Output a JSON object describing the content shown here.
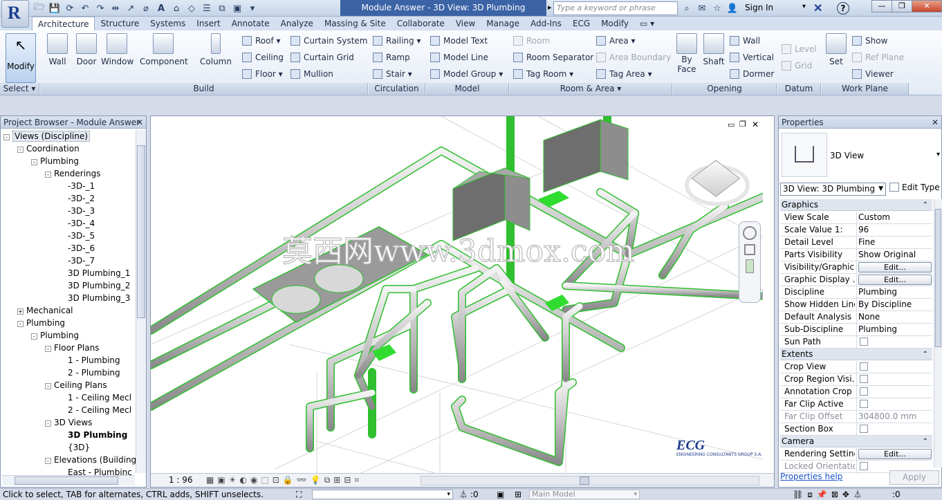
{
  "titlebar": {
    "document_title": "Module Answer - 3D View: 3D Plumbing",
    "search_placeholder": "Type a keyword or phrase",
    "sign_in": "Sign In"
  },
  "tabs": [
    "Architecture",
    "Structure",
    "Systems",
    "Insert",
    "Annotate",
    "Analyze",
    "Massing & Site",
    "Collaborate",
    "View",
    "Manage",
    "Add-Ins",
    "ECG",
    "Modify"
  ],
  "ribbon": {
    "modify": "Modify",
    "select": "Select",
    "build": {
      "label": "Build",
      "wall": "Wall",
      "door": "Door",
      "window": "Window",
      "component": "Component",
      "column": "Column",
      "roof": "Roof",
      "ceiling": "Ceiling",
      "floor": "Floor",
      "curtain_system": "Curtain System",
      "curtain_grid": "Curtain Grid",
      "mullion": "Mullion"
    },
    "circulation": {
      "label": "Circulation",
      "railing": "Railing",
      "ramp": "Ramp",
      "stair": "Stair"
    },
    "model": {
      "label": "Model",
      "model_text": "Model Text",
      "model_line": "Model Line",
      "model_group": "Model Group"
    },
    "room_area": {
      "label": "Room & Area",
      "room": "Room",
      "room_separator": "Room Separator",
      "tag_room": "Tag Room",
      "area": "Area",
      "area_boundary": "Area Boundary",
      "tag_area": "Tag Area"
    },
    "opening": {
      "label": "Opening",
      "by_face": "By\nFace",
      "shaft": "Shaft",
      "wall": "Wall",
      "vertical": "Vertical",
      "dormer": "Dormer"
    },
    "datum": {
      "label": "Datum",
      "level": "Level",
      "grid": "Grid"
    },
    "work_plane": {
      "label": "Work Plane",
      "set": "Set",
      "show": "Show",
      "ref_plane": "Ref Plane",
      "viewer": "Viewer"
    }
  },
  "project_browser": {
    "title": "Project Browser - Module Answer",
    "items": [
      {
        "label": "Views (Discipline)",
        "level": 0,
        "toggle": "-"
      },
      {
        "label": "Coordination",
        "level": 1,
        "toggle": "-"
      },
      {
        "label": "Plumbing",
        "level": 2,
        "toggle": "-"
      },
      {
        "label": "Renderings",
        "level": 3,
        "toggle": "-"
      },
      {
        "label": "-3D-_1",
        "level": 4,
        "toggle": ""
      },
      {
        "label": "-3D-_2",
        "level": 4,
        "toggle": ""
      },
      {
        "label": "-3D-_3",
        "level": 4,
        "toggle": ""
      },
      {
        "label": "-3D-_4",
        "level": 4,
        "toggle": ""
      },
      {
        "label": "-3D-_5",
        "level": 4,
        "toggle": ""
      },
      {
        "label": "-3D-_6",
        "level": 4,
        "toggle": ""
      },
      {
        "label": "-3D-_7",
        "level": 4,
        "toggle": ""
      },
      {
        "label": "3D Plumbing_1",
        "level": 4,
        "toggle": ""
      },
      {
        "label": "3D Plumbing_2",
        "level": 4,
        "toggle": ""
      },
      {
        "label": "3D Plumbing_3",
        "level": 4,
        "toggle": ""
      },
      {
        "label": "Mechanical",
        "level": 1,
        "toggle": "+"
      },
      {
        "label": "Plumbing",
        "level": 1,
        "toggle": "-"
      },
      {
        "label": "Plumbing",
        "level": 2,
        "toggle": "-"
      },
      {
        "label": "Floor Plans",
        "level": 3,
        "toggle": "-"
      },
      {
        "label": "1 - Plumbing",
        "level": 4,
        "toggle": ""
      },
      {
        "label": "2 - Plumbing",
        "level": 4,
        "toggle": ""
      },
      {
        "label": "Ceiling Plans",
        "level": 3,
        "toggle": "-"
      },
      {
        "label": "1 - Ceiling Mecl",
        "level": 4,
        "toggle": ""
      },
      {
        "label": "2 - Ceiling Mecl",
        "level": 4,
        "toggle": ""
      },
      {
        "label": "3D Views",
        "level": 3,
        "toggle": "-"
      },
      {
        "label": "3D Plumbing",
        "level": 4,
        "toggle": "",
        "bold": true
      },
      {
        "label": "{3D}",
        "level": 4,
        "toggle": ""
      },
      {
        "label": "Elevations (Building",
        "level": 3,
        "toggle": "-"
      },
      {
        "label": "East - Plumbinc",
        "level": 4,
        "toggle": ""
      }
    ]
  },
  "view": {
    "scale": "1 : 96",
    "watermark": "莫西网www.3dmox.com",
    "logo_text": "ECG",
    "logo_subtext": "ENGINEERING CONSULTANTS GROUP S.A."
  },
  "properties": {
    "title": "Properties",
    "type_name": "3D View",
    "type_selector": "3D View: 3D Plumbing",
    "edit_type": "Edit Type",
    "groups": [
      {
        "name": "Graphics",
        "rows": [
          {
            "k": "View Scale",
            "v": "Custom"
          },
          {
            "k": "Scale Value    1:",
            "v": "96"
          },
          {
            "k": "Detail Level",
            "v": "Fine"
          },
          {
            "k": "Parts Visibility",
            "v": "Show Original"
          },
          {
            "k": "Visibility/Graphic...",
            "v": "Edit...",
            "btn": true
          },
          {
            "k": "Graphic Display ...",
            "v": "Edit...",
            "btn": true
          },
          {
            "k": "Discipline",
            "v": "Plumbing"
          },
          {
            "k": "Show Hidden Lines",
            "v": "By Discipline"
          },
          {
            "k": "Default Analysis ...",
            "v": "None"
          },
          {
            "k": "Sub-Discipline",
            "v": "Plumbing"
          },
          {
            "k": "Sun Path",
            "v": "",
            "chk": true
          }
        ]
      },
      {
        "name": "Extents",
        "rows": [
          {
            "k": "Crop View",
            "v": "",
            "chk": true
          },
          {
            "k": "Crop Region Visi...",
            "v": "",
            "chk": true
          },
          {
            "k": "Annotation Crop",
            "v": "",
            "chk": true
          },
          {
            "k": "Far Clip Active",
            "v": "",
            "chk": true
          },
          {
            "k": "Far Clip Offset",
            "v": "304800.0 mm",
            "dis": true
          },
          {
            "k": "Section Box",
            "v": "",
            "chk": true
          }
        ]
      },
      {
        "name": "Camera",
        "rows": [
          {
            "k": "Rendering Settings",
            "v": "Edit...",
            "btn": true
          },
          {
            "k": "Locked Orientation",
            "v": "",
            "chk": true,
            "dis": true
          }
        ]
      }
    ],
    "help_link": "Properties help",
    "apply": "Apply"
  },
  "status": {
    "message": "Click to select, TAB for alternates, CTRL adds, SHIFT unselects.",
    "filter_count": ":0",
    "workset": "Main Model",
    "select_count": ":0"
  }
}
